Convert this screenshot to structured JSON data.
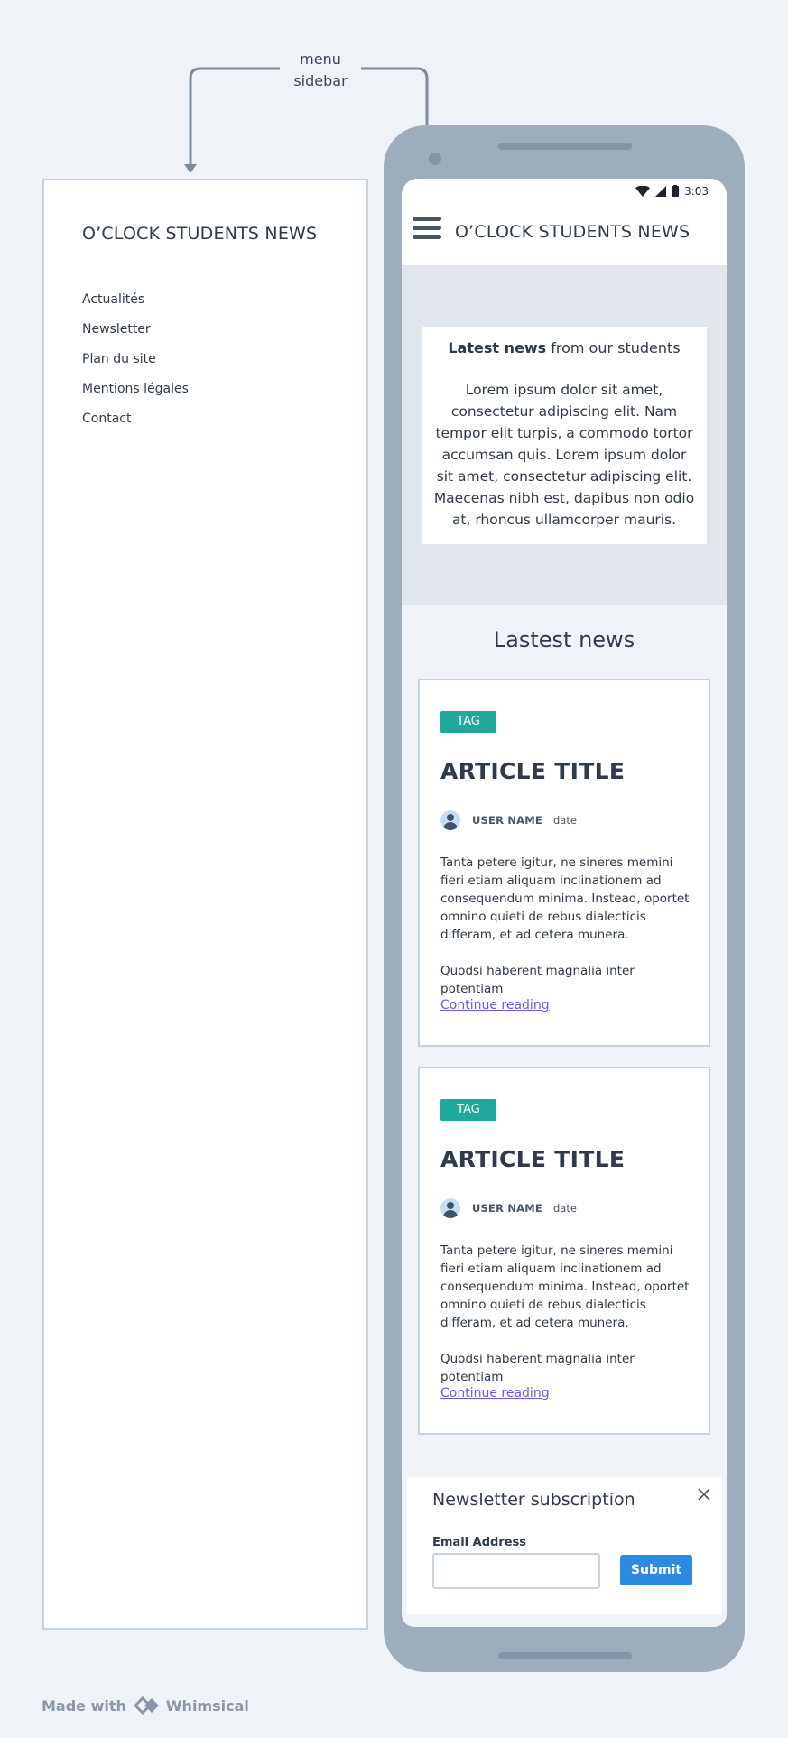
{
  "annotation": {
    "line1": "menu",
    "line2": "sidebar"
  },
  "sidebar": {
    "title": "O’CLOCK STUDENTS NEWS",
    "items": [
      {
        "label": "Actualités"
      },
      {
        "label": "Newsletter"
      },
      {
        "label": "Plan du site"
      },
      {
        "label": "Mentions légales"
      },
      {
        "label": "Contact"
      }
    ]
  },
  "status_bar": {
    "time": "3:03"
  },
  "header": {
    "title": "O’CLOCK STUDENTS NEWS",
    "menu_icon": "hamburger-icon"
  },
  "hero": {
    "heading_bold": "Latest news",
    "heading_rest": " from our students",
    "text": "Lorem ipsum dolor sit amet, consectetur adipiscing elit. Nam tempor elit turpis, a commodo tortor accumsan quis. Lorem ipsum dolor sit amet, consectetur adipiscing elit. Maecenas nibh est, dapibus non odio at, rhoncus ullamcorper mauris."
  },
  "latest": {
    "title": "Lastest news"
  },
  "articles": [
    {
      "tag": "TAG",
      "title": "ARTICLE TITLE",
      "user": "USER NAME",
      "date": "date",
      "text": "Tanta petere igitur, ne sineres memini fieri etiam aliquam inclinationem ad consequendum minima. Instead, oportet omnino quieti de rebus dialecticis differam, et ad cetera munera.",
      "text2": "Quodsi haberent magnalia inter potentiam",
      "link": "Continue reading"
    },
    {
      "tag": "TAG",
      "title": "ARTICLE TITLE",
      "user": "USER NAME",
      "date": "date",
      "text": "Tanta petere igitur, ne sineres memini fieri etiam aliquam inclinationem ad consequendum minima. Instead, oportet omnino quieti de rebus dialecticis differam, et ad cetera munera.",
      "text2": "Quodsi haberent magnalia inter potentiam",
      "link": "Continue reading"
    }
  ],
  "newsletter": {
    "title": "Newsletter subscription",
    "email_label": "Email Address",
    "email_value": "",
    "submit_label": "Submit"
  },
  "footer": {
    "made_with": "Made with",
    "brand": "Whimsical"
  },
  "colors": {
    "background": "#eff3f7",
    "phone_frame": "#9eadbb",
    "tag": "#20a99a",
    "link": "#6a5ae0",
    "submit": "#2c8be0",
    "border": "#c7d3e0"
  }
}
